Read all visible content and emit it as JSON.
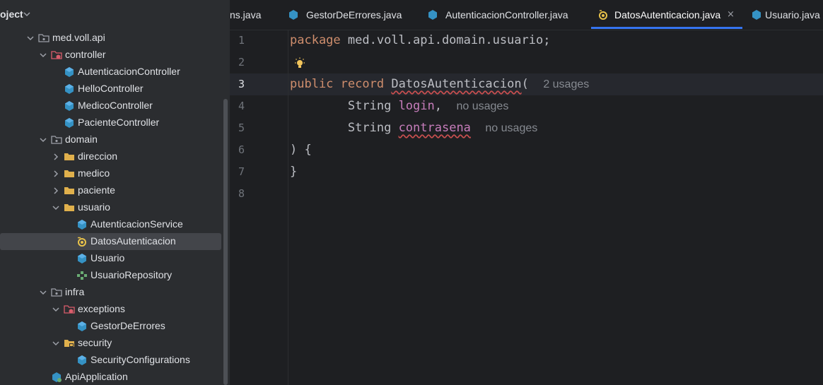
{
  "project_panel": {
    "title": "oject",
    "tree": [
      {
        "label": "med.voll.api",
        "icon": "package-folder-icon",
        "expanded": true
      },
      {
        "label": "controller",
        "icon": "controller-folder-icon",
        "expanded": true
      },
      {
        "label": "AutenticacionController",
        "icon": "class-icon"
      },
      {
        "label": "HelloController",
        "icon": "class-icon"
      },
      {
        "label": "MedicoController",
        "icon": "class-icon"
      },
      {
        "label": "PacienteController",
        "icon": "class-icon"
      },
      {
        "label": "domain",
        "icon": "package-folder-icon",
        "expanded": true
      },
      {
        "label": "direccion",
        "icon": "folder-icon",
        "expanded": false
      },
      {
        "label": "medico",
        "icon": "folder-icon",
        "expanded": false
      },
      {
        "label": "paciente",
        "icon": "folder-icon",
        "expanded": false
      },
      {
        "label": "usuario",
        "icon": "folder-icon",
        "expanded": true
      },
      {
        "label": "AutenticacionService",
        "icon": "class-icon"
      },
      {
        "label": "DatosAutenticacion",
        "icon": "record-icon",
        "selected": true
      },
      {
        "label": "Usuario",
        "icon": "class-icon"
      },
      {
        "label": "UsuarioRepository",
        "icon": "interface-icon"
      },
      {
        "label": "infra",
        "icon": "package-folder-icon",
        "expanded": true
      },
      {
        "label": "exceptions",
        "icon": "exceptions-folder-icon",
        "expanded": true
      },
      {
        "label": "GestorDeErrores",
        "icon": "class-icon"
      },
      {
        "label": "security",
        "icon": "security-folder-icon",
        "expanded": true
      },
      {
        "label": "SecurityConfigurations",
        "icon": "class-icon"
      },
      {
        "label": "ApiApplication",
        "icon": "spring-app-icon"
      }
    ]
  },
  "tabs": [
    {
      "label": "ns.java",
      "icon": "class-icon"
    },
    {
      "label": "GestorDeErrores.java",
      "icon": "class-icon"
    },
    {
      "label": "AutenticacionController.java",
      "icon": "class-icon"
    },
    {
      "label": "DatosAutenticacion.java",
      "icon": "record-icon",
      "active": true
    },
    {
      "label": "Usuario.java",
      "icon": "class-icon"
    }
  ],
  "tab_close": "×",
  "editor": {
    "line_numbers": [
      "1",
      "2",
      "3",
      "4",
      "5",
      "6",
      "7",
      "8"
    ],
    "current_line": 3,
    "code": {
      "l1_kw": "package",
      "l1_rest": " med.voll.api.domain.usuario;",
      "l3_kw1": "public",
      "l3_kw2": "record",
      "l3_name": "DatosAutenticacion",
      "l3_paren": "(",
      "l3_hint": "2 usages",
      "l4_type": "String",
      "l4_param": "login",
      "l4_comma": ",",
      "l4_hint": "no usages",
      "l5_type": "String",
      "l5_param": "contrasena",
      "l5_hint": "no usages",
      "l6": ") {",
      "l7": "}"
    }
  },
  "colors": {
    "accent": "#3574f0",
    "keyword": "#cf8e6d",
    "parameter": "#c77dbb",
    "hint": "#868a91",
    "error_underline": "#c94f4f"
  }
}
